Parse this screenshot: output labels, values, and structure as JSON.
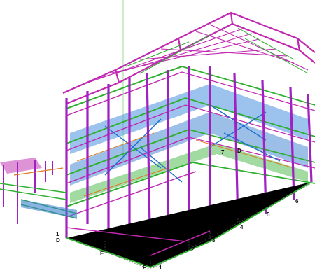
{
  "viewport": {
    "background": "#ffffff",
    "member_colors": {
      "columns": "#a020c0",
      "beams": "#c028b0",
      "bracing_green": "#2fb02f",
      "bracing_blue": "#1e6fd0",
      "floor_blue": "#4a90e0",
      "secondary_orange": "#e07a20",
      "gridline": "#555555"
    },
    "gridline_labels": [
      {
        "id": "grid-1-left",
        "text": "1"
      },
      {
        "id": "grid-d-left",
        "text": "D"
      },
      {
        "id": "grid-e",
        "text": "E"
      },
      {
        "id": "grid-f",
        "text": "F"
      },
      {
        "id": "grid-1-front",
        "text": "1"
      },
      {
        "id": "grid-2",
        "text": "2"
      },
      {
        "id": "grid-3",
        "text": "3"
      },
      {
        "id": "grid-4",
        "text": "4"
      },
      {
        "id": "grid-5",
        "text": "5"
      },
      {
        "id": "grid-6",
        "text": "6"
      },
      {
        "id": "grid-7",
        "text": "7"
      },
      {
        "id": "grid-d-inner",
        "text": "D"
      }
    ]
  }
}
